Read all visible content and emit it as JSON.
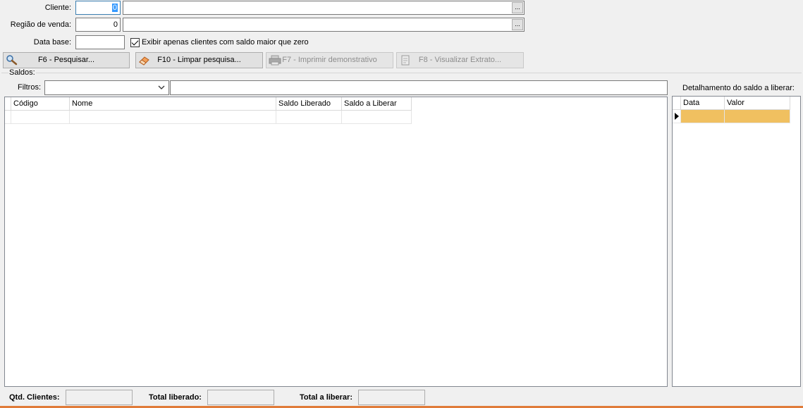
{
  "filters": {
    "cliente_label": "Cliente:",
    "cliente_code": "0",
    "cliente_name": "",
    "regiao_label": "Região de venda:",
    "regiao_code": "0",
    "regiao_name": "",
    "data_base_label": "Data base:",
    "data_base_value": "",
    "checkbox_label": "Exibir apenas clientes com saldo maior que zero",
    "checkbox_checked": true,
    "ellipsis": "..."
  },
  "toolbar": {
    "search": "F6 - Pesquisar...",
    "clear": "F10 - Limpar pesquisa...",
    "print": "F7 - Imprimir demonstrativo",
    "extract": "F8 - Visualizar Extrato..."
  },
  "saldos": {
    "group_label": "Saldos:",
    "filtros_label": "Filtros:",
    "filtros_value": "",
    "filtros_text": "",
    "columns": [
      "Código",
      "Nome",
      "Saldo Liberado",
      "Saldo a Liberar"
    ]
  },
  "detalhe": {
    "title": "Detalhamento do saldo a liberar:",
    "columns": [
      "Data",
      "Valor"
    ],
    "selected_row_color": "#f0c060"
  },
  "footer": {
    "qtd_label": "Qtd. Clientes:",
    "qtd_value": "",
    "liberado_label": "Total liberado:",
    "liberado_value": "",
    "a_liberar_label": "Total a liberar:",
    "a_liberar_value": ""
  },
  "colors": {
    "bottom_accent": "#e07b39",
    "focus_border": "#3c7fb1",
    "selection": "#3399ff"
  }
}
